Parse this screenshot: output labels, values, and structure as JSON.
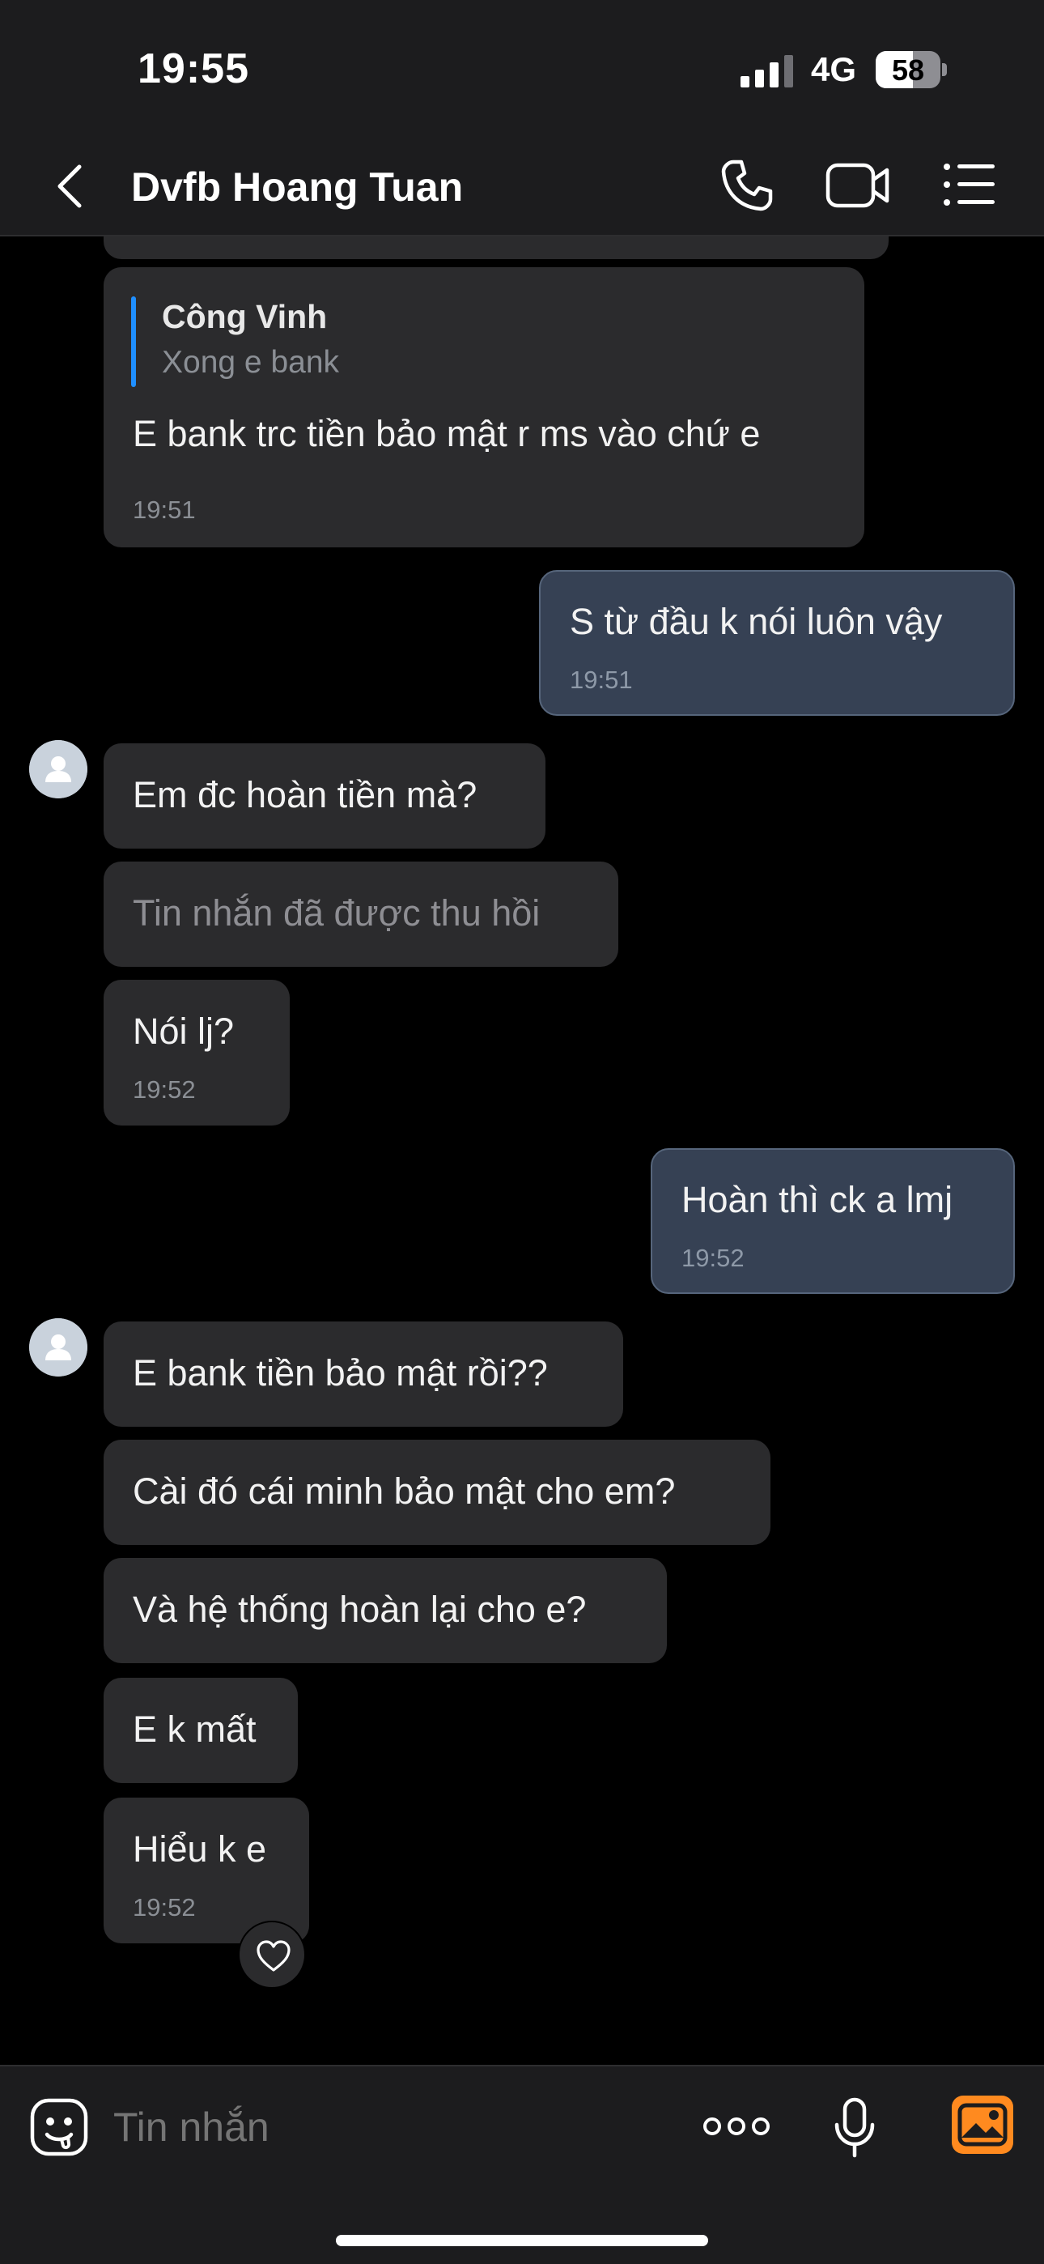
{
  "status": {
    "time": "19:55",
    "network": "4G",
    "battery": "58",
    "battery_level": 0.58
  },
  "header": {
    "title": "Dvfb Hoang Tuan"
  },
  "messages": [
    {
      "quote_name": "Công Vinh",
      "quote_text": "Xong e bank",
      "text": "E bank trc tiền bảo mật r ms vào chứ e",
      "time": "19:51"
    },
    {
      "text": "S từ đầu k nói luôn vậy",
      "time": "19:51"
    },
    {
      "text": "Em đc hoàn tiền mà?"
    },
    {
      "text": "Tin nhắn đã được thu hồi"
    },
    {
      "text": "Nói lj?",
      "time": "19:52"
    },
    {
      "text": "Hoàn thì ck a lmj",
      "time": "19:52"
    },
    {
      "text": "E bank tiền bảo mật rồi??"
    },
    {
      "text": "Cài đó cái minh bảo mật cho em?"
    },
    {
      "text": "Và hệ thống hoàn lại cho e?"
    },
    {
      "text": "E k mất"
    },
    {
      "text": "Hiểu k e",
      "time": "19:52"
    }
  ],
  "input": {
    "placeholder": "Tin nhắn"
  },
  "icons": {
    "back": "chevron-left-icon",
    "call": "phone-icon",
    "video": "video-camera-icon",
    "menu": "list-icon",
    "sticker": "sticker-icon",
    "more": "more-icon",
    "mic": "microphone-icon",
    "image": "image-icon",
    "reaction": "heart-icon"
  },
  "colors": {
    "accent": "#1f8fff",
    "outgoing_bubble": "#364154",
    "incoming_bubble": "#2b2b2d",
    "image_button": "#ff8a1f"
  }
}
